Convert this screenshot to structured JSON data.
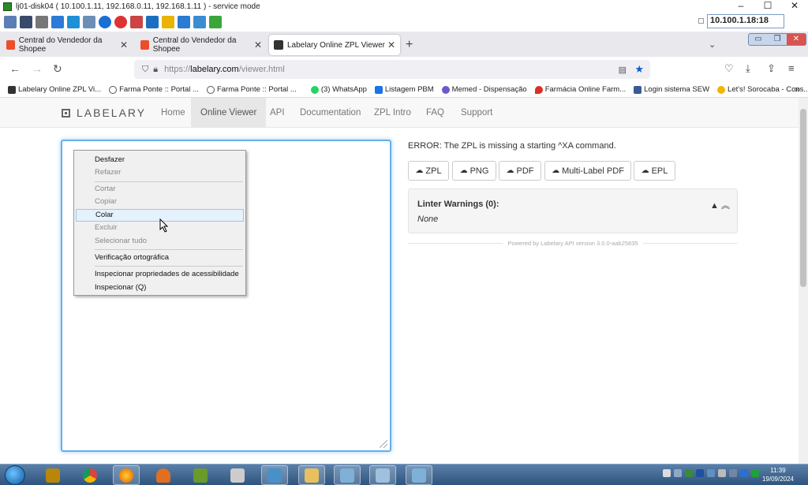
{
  "remote": {
    "title": "lj01-disk04 ( 10.100.1.11, 192.168.0.11, 192.168.1.11 ) - service mode",
    "ip_box": "10.100.1.18:18",
    "window_buttons": [
      "–",
      "☐",
      "✕"
    ]
  },
  "browser": {
    "tabs": [
      {
        "label": "Central do Vendedor da Shopee",
        "icon": "shopee-icon",
        "color": "#ee4d2d"
      },
      {
        "label": "Central do Vendedor da Shopee",
        "icon": "shopee-icon",
        "color": "#ee4d2d"
      },
      {
        "label": "Labelary Online ZPL Viewer",
        "icon": "labelary-icon",
        "color": "#333333",
        "active": true
      }
    ],
    "url_prefix": "https://",
    "url_host": "labelary.com",
    "url_path": "/viewer.html",
    "bookmarks": [
      {
        "label": "Labelary Online ZPL Vi...",
        "color": "#333333"
      },
      {
        "label": "Farma Ponte :: Portal ...",
        "color": "#555555"
      },
      {
        "label": "Farma Ponte :: Portal ...",
        "color": "#555555"
      },
      {
        "label": "(3) WhatsApp",
        "color": "#25d366"
      },
      {
        "label": "Listagem PBM",
        "color": "#1a73e8"
      },
      {
        "label": "Memed - Dispensação",
        "color": "#6a5acd"
      },
      {
        "label": "Farmácia Online Farm...",
        "color": "#d93025"
      },
      {
        "label": "Login sistema SEW",
        "color": "#3b5998"
      },
      {
        "label": "Let's! Sorocaba - Cons...",
        "color": "#f4b400"
      }
    ],
    "bookmarks_more": "»"
  },
  "site": {
    "brand": "LABELARY",
    "nav": [
      "Home",
      "Online Viewer",
      "API",
      "Documentation",
      "ZPL Intro",
      "FAQ",
      "Support"
    ],
    "active_nav": "Online Viewer",
    "error": "ERROR: The ZPL is missing a starting ^XA command.",
    "buttons": [
      "ZPL",
      "PNG",
      "PDF",
      "Multi-Label PDF",
      "EPL"
    ],
    "linter_title": "Linter Warnings (0):",
    "linter_body": "None",
    "powered_by": "Powered by Labelary API version 3.0.0-aab25835"
  },
  "context_menu": {
    "items": [
      {
        "label": "Desfazer",
        "enabled": true
      },
      {
        "label": "Refazer",
        "enabled": false
      },
      {
        "label": "Cortar",
        "enabled": false
      },
      {
        "label": "Copiar",
        "enabled": false
      },
      {
        "label": "Colar",
        "enabled": true,
        "highlighted": true
      },
      {
        "label": "Excluir",
        "enabled": false
      },
      {
        "label": "Selecionar tudo",
        "enabled": false
      },
      {
        "label": "Verificação ortográfica",
        "enabled": true
      },
      {
        "label": "Inspecionar propriedades de acessibilidade",
        "enabled": true
      },
      {
        "label": "Inspecionar (Q)",
        "enabled": true
      }
    ]
  },
  "taskbar": {
    "time": "11:39",
    "date": "19/09/2024"
  }
}
